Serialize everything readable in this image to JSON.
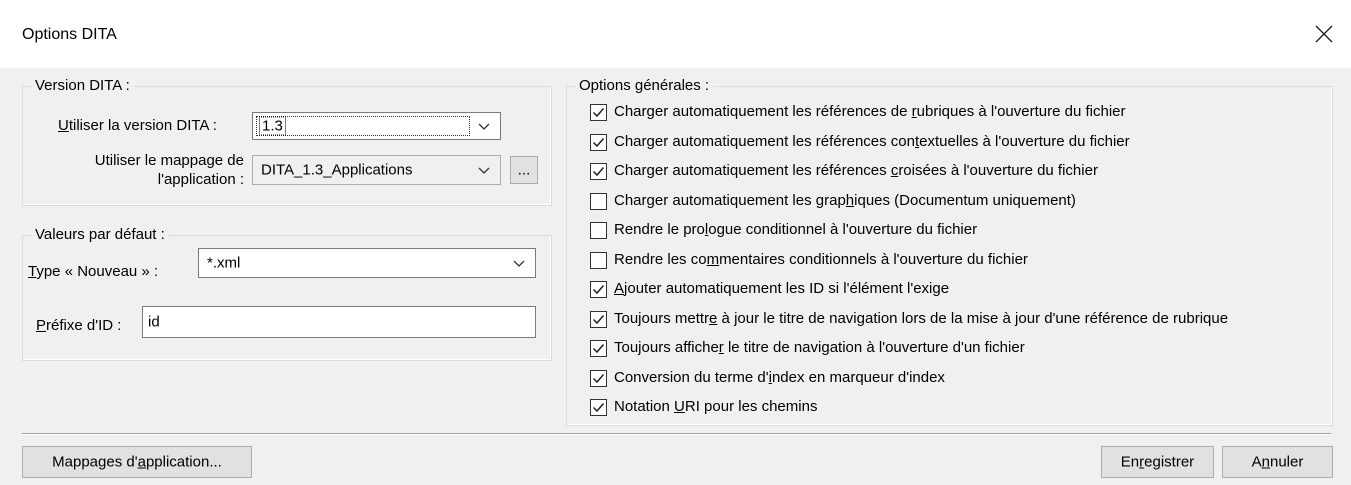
{
  "dialog": {
    "title": "Options DITA"
  },
  "version_group": {
    "legend": "Version DITA :",
    "version_label_pre": "",
    "version_label_u": "U",
    "version_label_post": "tiliser la version DITA :",
    "version_value": "1.3",
    "mapping_label_line1_pre": "Utiliser le mappa",
    "mapping_label_line1_u": "g",
    "mapping_label_line1_post": "e de",
    "mapping_label_line2": "l'application :",
    "mapping_value": "DITA_1.3_Applications",
    "browse_label": "..."
  },
  "defaults_group": {
    "legend": "Valeurs par défaut :",
    "type_label_u": "T",
    "type_label_post": "ype « Nouveau » :",
    "type_value": "*.xml",
    "prefix_label_u": "P",
    "prefix_label_post": "réfixe d'ID :",
    "prefix_value": "id"
  },
  "general_group": {
    "legend": "Options générales :",
    "options": [
      {
        "pre": "Charger automatiquement les références de ",
        "u": "r",
        "post": "ubriques à l'ouverture du fichier",
        "checked": true
      },
      {
        "pre": "Charger automatiquement les références con",
        "u": "t",
        "post": "extuelles à l'ouverture du fichier",
        "checked": true
      },
      {
        "pre": "Charger automatiquement les références ",
        "u": "c",
        "post": "roisées à l'ouverture du fichier",
        "checked": true
      },
      {
        "pre": "Charger automatiquement les grap",
        "u": "h",
        "post": "iques (Documentum uniquement)",
        "checked": false
      },
      {
        "pre": "Rendre le pro",
        "u": "l",
        "post": "ogue conditionnel à l'ouverture du fichier",
        "checked": false
      },
      {
        "pre": "Rendre les co",
        "u": "m",
        "post": "mentaires conditionnels à l'ouverture du fichier",
        "checked": false
      },
      {
        "pre": "",
        "u": "A",
        "post": "jouter automatiquement les ID si l'élément l'exige",
        "checked": true
      },
      {
        "pre": "Toujours mettr",
        "u": "e",
        "post": " à jour le titre de navigation lors de la mise à jour d'une référence de rubrique",
        "checked": true
      },
      {
        "pre": "Toujours affiche",
        "u": "r",
        "post": " le titre de navigation à l'ouverture d'un fichier",
        "checked": true
      },
      {
        "pre": "Conversion du terme d'",
        "u": "i",
        "post": "ndex en marqueur d'index",
        "checked": true
      },
      {
        "pre": "Notation ",
        "u": "U",
        "post": "RI pour les chemins",
        "checked": true
      }
    ]
  },
  "buttons": {
    "mappings_pre": "Mappages d'",
    "mappings_u": "a",
    "mappings_post": "pplication...",
    "save_pre": "En",
    "save_u": "r",
    "save_post": "egistrer",
    "cancel_pre": "A",
    "cancel_u": "n",
    "cancel_post": "nuler"
  },
  "icons": {
    "close": "close-icon",
    "dropdown": "chevron-down-icon",
    "check": "checkmark-icon"
  }
}
